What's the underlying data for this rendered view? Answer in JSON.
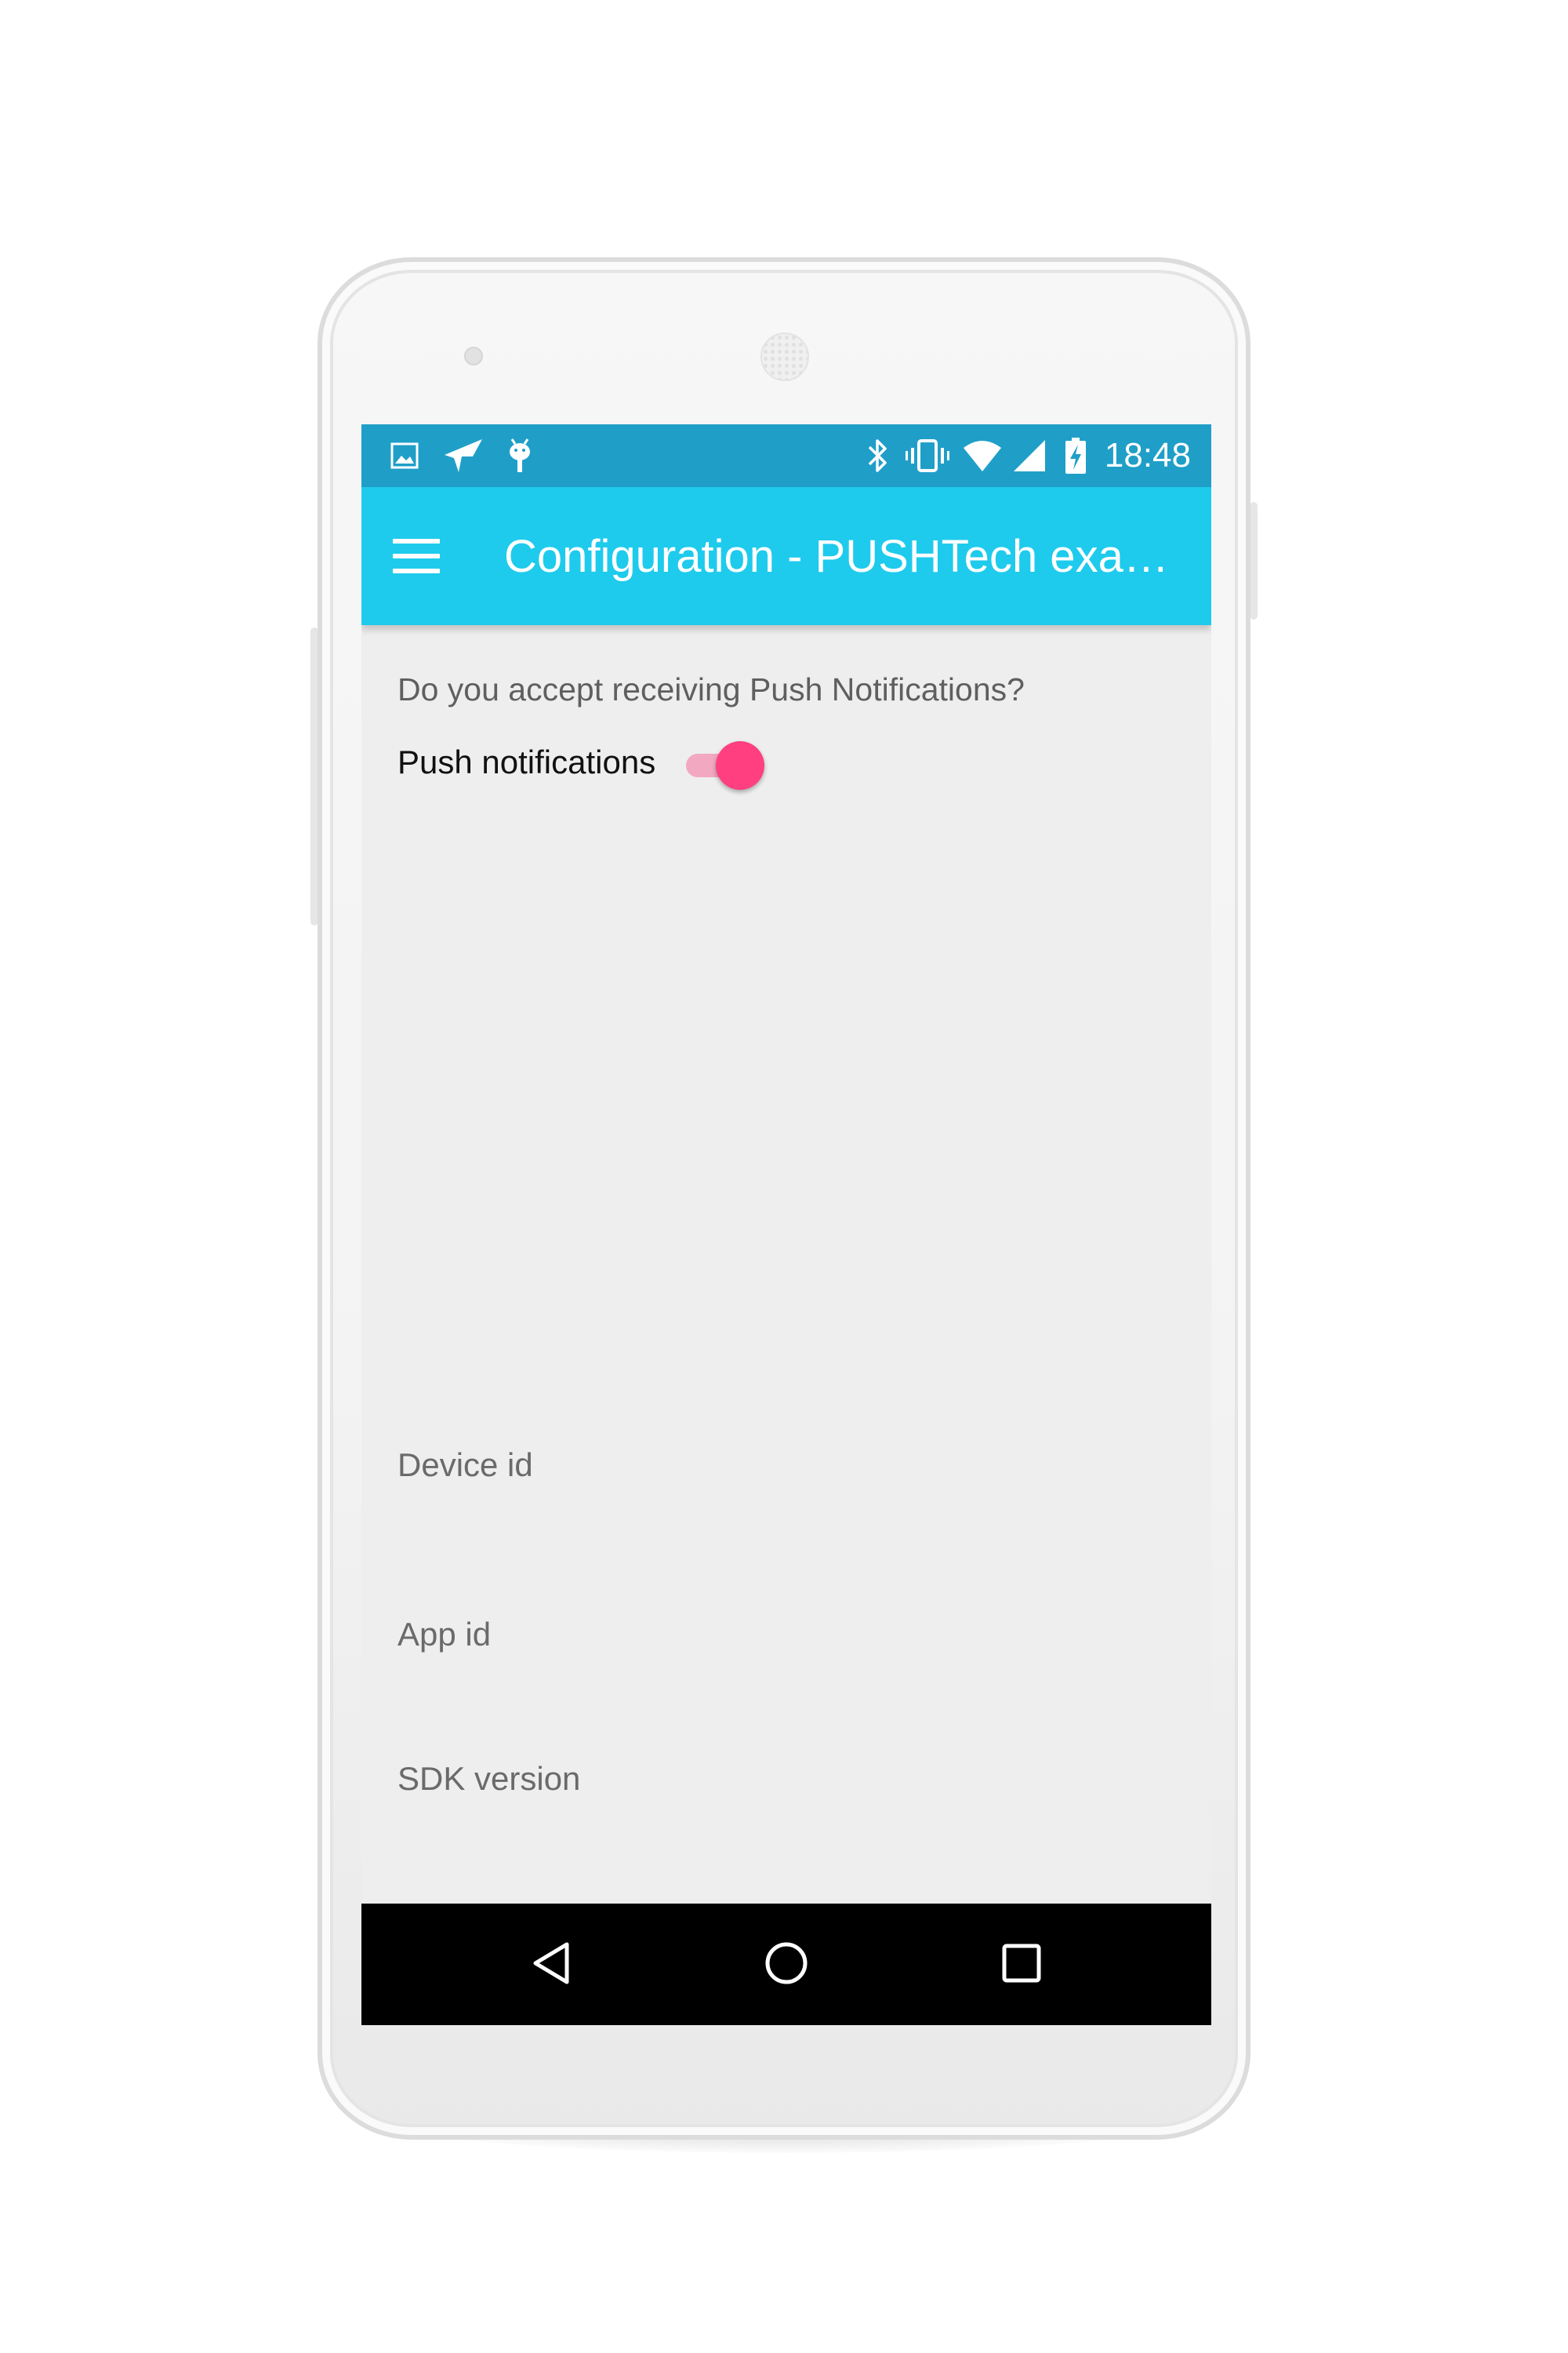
{
  "status_bar": {
    "time": "18:48",
    "left_icons": [
      "image-notification-icon",
      "pushtech-notification-icon",
      "android-debug-icon"
    ],
    "right_icons": [
      "bluetooth-icon",
      "vibrate-icon",
      "wifi-icon",
      "signal-icon",
      "battery-charging-icon"
    ]
  },
  "app_bar": {
    "menu_icon": "hamburger-menu-icon",
    "title": "Configuration - PUSHTech exa…"
  },
  "content": {
    "question": "Do you accept receiving Push Notifications?",
    "push_label": "Push notifications",
    "push_enabled": true,
    "device_id_label": "Device id",
    "app_id_label": "App id",
    "sdk_version_label": "SDK version"
  },
  "nav_bar": {
    "back_icon": "back-triangle-icon",
    "home_icon": "home-circle-icon",
    "recents_icon": "recents-square-icon"
  },
  "colors": {
    "status_bar": "#1f9fc8",
    "app_bar": "#1ecbec",
    "accent": "#ff3f80",
    "switch_track": "#f1a8c0",
    "background": "#eeeeee"
  }
}
